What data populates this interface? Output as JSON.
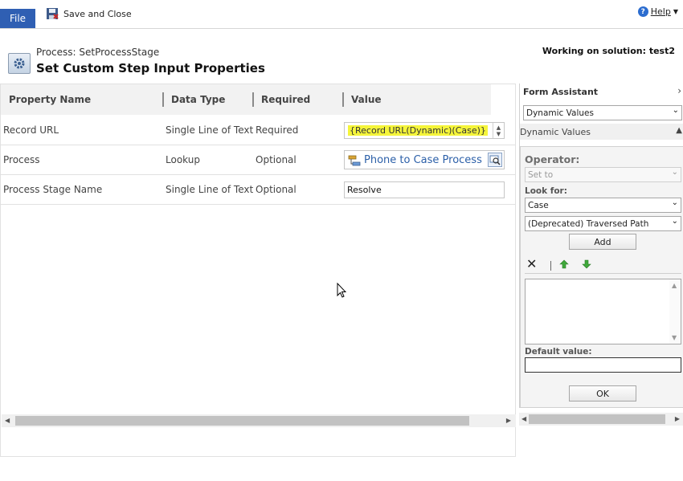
{
  "ribbon": {
    "file_label": "File",
    "save_close_label": "Save and Close",
    "help_label": "Help"
  },
  "header": {
    "subtitle": "Process: SetProcessStage",
    "title": "Set Custom Step Input Properties",
    "solution": "Working on solution: test2"
  },
  "grid": {
    "columns": [
      "Property Name",
      "Data Type",
      "Required",
      "Value"
    ],
    "rows": [
      {
        "name": "Record URL",
        "type": "Single Line of Text",
        "required": "Required",
        "value": "{Record URL(Dynamic)(Case)}"
      },
      {
        "name": "Process",
        "type": "Lookup",
        "required": "Optional",
        "value": "Phone to Case Process"
      },
      {
        "name": "Process Stage Name",
        "type": "Single Line of Text",
        "required": "Optional",
        "value": "Resolve"
      }
    ]
  },
  "assistant": {
    "title": "Form Assistant",
    "mode_select": "Dynamic Values",
    "section_label": "Dynamic Values",
    "operator_label": "Operator:",
    "operator_value": "Set to",
    "look_for_label": "Look for:",
    "look_for_value": "Case",
    "path_value": "(Deprecated) Traversed Path",
    "add_label": "Add",
    "default_value_label": "Default value:",
    "ok_label": "OK"
  },
  "colors": {
    "file_button": "#2f5fb3",
    "highlight": "#f5f53a",
    "link": "#2b5fa8",
    "arrow_green": "#3fa83a"
  }
}
